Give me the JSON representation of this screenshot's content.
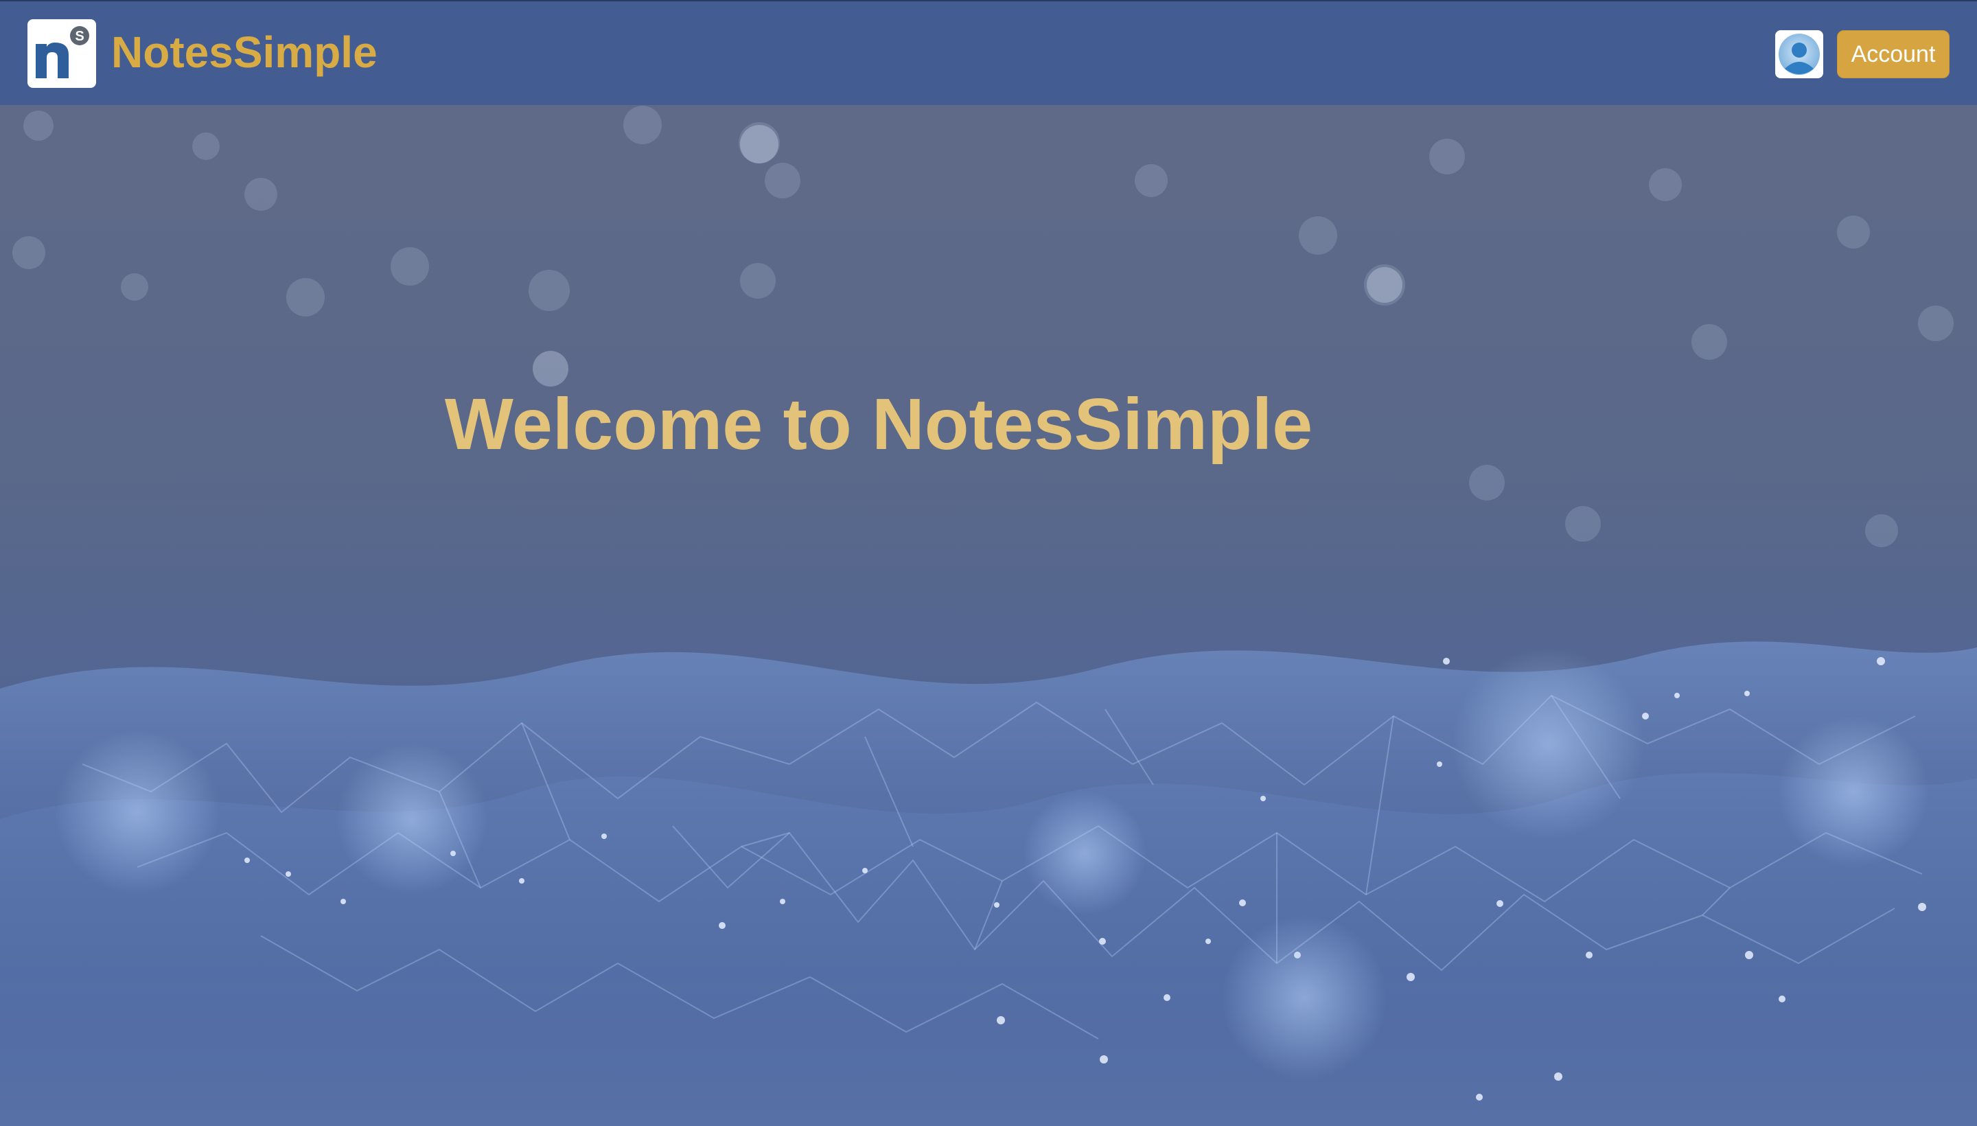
{
  "header": {
    "brand": "NotesSimple",
    "logo_icon": "notessimple-logo-icon",
    "avatar_icon": "user-avatar-icon",
    "account_label": "Account"
  },
  "hero": {
    "title": "Welcome to NotesSimple",
    "background": "network-mesh-background"
  },
  "colors": {
    "header_bg": "#435d92",
    "brand_gold": "#d8ab45",
    "button_gold": "#d6a542",
    "hero_title": "#e3c27a",
    "hero_bg": "#5d6a8c"
  }
}
